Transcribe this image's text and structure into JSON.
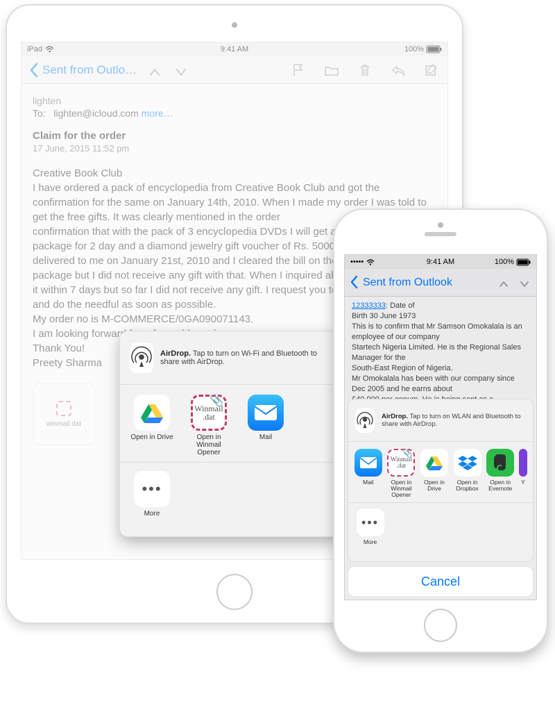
{
  "ipad": {
    "statusbar": {
      "carrier": "iPad",
      "time": "9:41 AM",
      "battery": "100%"
    },
    "nav": {
      "back_label": "Sent from Outlo…"
    },
    "mail": {
      "sender": "lighten",
      "to_label": "To:",
      "to_address": "lighten@icloud.com",
      "more": "more…",
      "subject": "Claim for the order",
      "date": "17 June, 2015 11:52 pm",
      "body": "Creative Book Club\nI have ordered a pack of encyclopedia from Creative Book Club and got the confirmation for the same on January 14th, 2010. When I made my order I was told to get the free gifts. It was clearly mentioned in the order\nconfirmation that with the pack of 3 encyclopedia DVDs I will get a travel bag, a holiday package for 2 day and a diamond jewelry gift voucher of Rs. 5000. The order was delivered to me on January 21st, 2010 and I cleared the bill on the delivery of the package but I did not receive any gift with that. When I inquired about it I was told to get it within 7 days but so far I did not receive any gift. I request you to look into the matter and do the needful as soon as possible.\nMy order no is M-COMMERCE/0GA090071143.\nI am looking forward for a favorable reply.\nThank You!\nPreety Sharma",
      "attachment_name": "winmail.dat"
    },
    "share": {
      "airdrop_title": "AirDrop.",
      "airdrop_desc": "Tap to turn on Wi-Fi and Bluetooth to share with AirDrop.",
      "apps": [
        {
          "label": "Open in Drive"
        },
        {
          "label": "Open in Winmail Opener"
        },
        {
          "label": "Mail"
        }
      ],
      "more": "More"
    }
  },
  "iphone": {
    "statusbar": {
      "signal": "•••••",
      "time": "9:41 AM",
      "battery": "100%"
    },
    "nav": {
      "back_label": "Sent from Outlook"
    },
    "mail": {
      "link": "12333333",
      "body": ": Date of\nBirth 30 June 1973\nThis is to confirm that Mr Samson Omokalala is an employee of our company\nStartech Nigeria Limited. He is the Regional Sales Manager for the\nSouth-East Region of Nigeria.\nMr Omokalala has been with our company since Dec 2005 and he earns about\n£40,000 per annum. He is being sent as a representative of our company to\nthe Annual Conference for Widgets. Titled - How to Sell"
    },
    "share": {
      "airdrop_title": "AirDrop.",
      "airdrop_desc": "Tap to turn on WLAN and Bluetooth to share with AirDrop.",
      "apps": [
        {
          "label": "Mail"
        },
        {
          "label": "Open in Winmail Opener"
        },
        {
          "label": "Open in Drive"
        },
        {
          "label": "Open in Dropbox"
        },
        {
          "label": "Open in Evernote"
        },
        {
          "label": "Y"
        }
      ],
      "more": "More",
      "cancel": "Cancel"
    }
  }
}
